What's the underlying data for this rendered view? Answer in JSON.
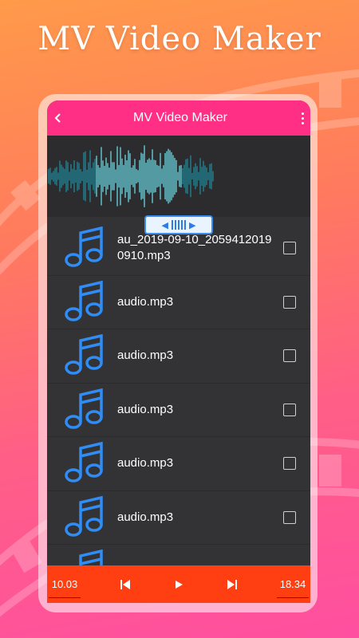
{
  "promo": {
    "title": "MV Video Maker"
  },
  "appbar": {
    "title": "MV Video Maker"
  },
  "files": [
    {
      "name": "au_2019-09-10_20594120190910.mp3"
    },
    {
      "name": "audio.mp3"
    },
    {
      "name": "audio.mp3"
    },
    {
      "name": "audio.mp3"
    },
    {
      "name": "audio.mp3"
    },
    {
      "name": "audio.mp3"
    }
  ],
  "player": {
    "current_time": "10.03",
    "total_time": "18.34"
  },
  "colors": {
    "appbar": "#ff2f86",
    "player": "#ff3f12",
    "note": "#2f8df5",
    "wave": "#27c3d9"
  },
  "icons": [
    "back-arrow-icon",
    "more-vertical-icon",
    "music-note-icon",
    "checkbox-icon",
    "skip-previous-icon",
    "play-icon",
    "skip-next-icon"
  ]
}
